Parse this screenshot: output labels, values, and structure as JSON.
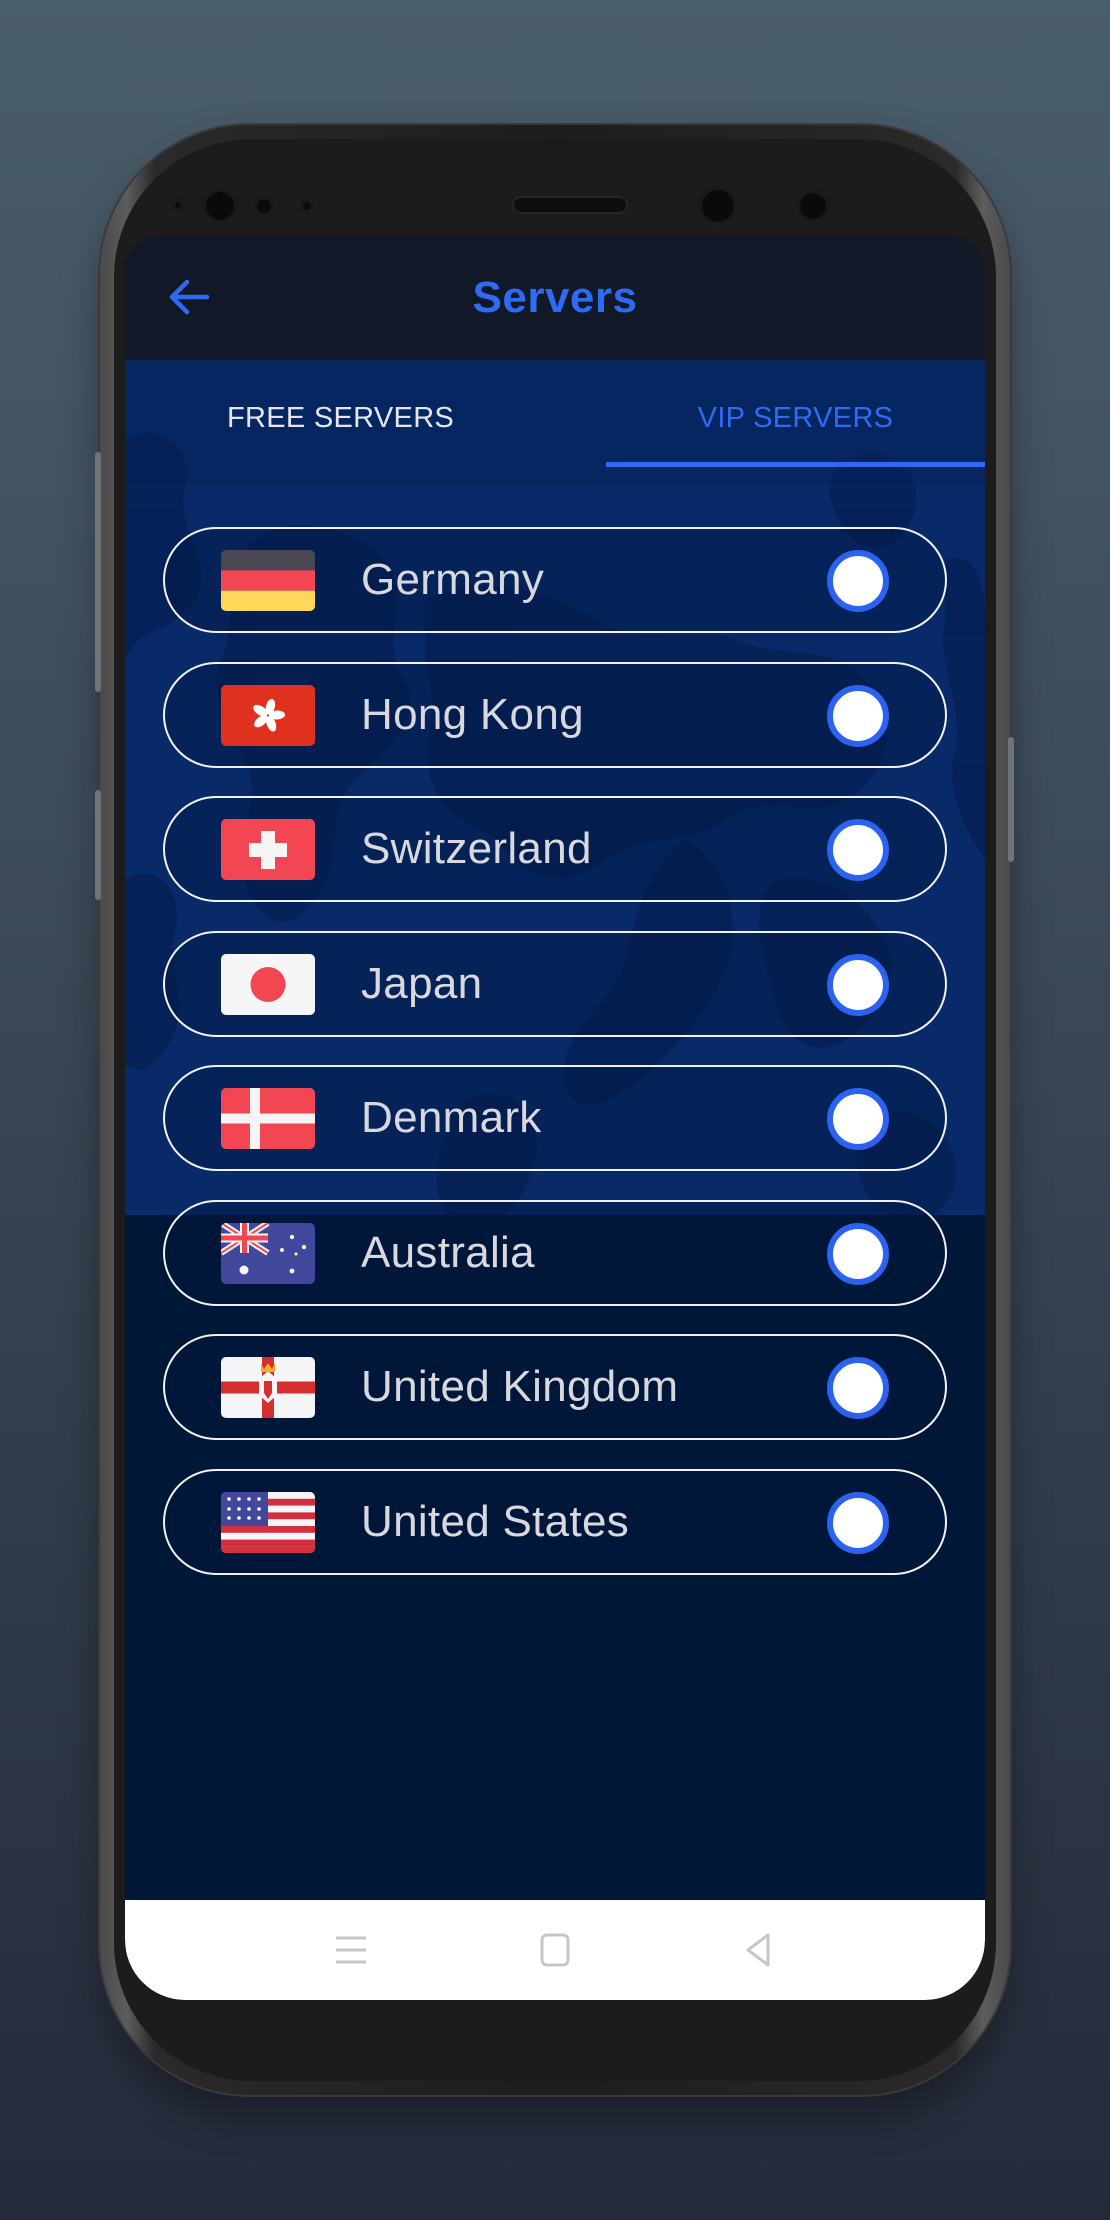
{
  "header": {
    "title": "Servers",
    "back_icon": "arrow-left-icon"
  },
  "tabs": [
    {
      "label": "FREE SERVERS",
      "active": false
    },
    {
      "label": "VIP SERVERS",
      "active": true
    }
  ],
  "servers": [
    {
      "name": "Germany",
      "flag": "germany-flag",
      "selected": false
    },
    {
      "name": "Hong Kong",
      "flag": "hong-kong-flag",
      "selected": false
    },
    {
      "name": "Switzerland",
      "flag": "switzerland-flag",
      "selected": false
    },
    {
      "name": "Japan",
      "flag": "japan-flag",
      "selected": false
    },
    {
      "name": "Denmark",
      "flag": "denmark-flag",
      "selected": false
    },
    {
      "name": "Australia",
      "flag": "australia-flag",
      "selected": false
    },
    {
      "name": "United Kingdom",
      "flag": "northern-ireland-flag",
      "selected": false
    },
    {
      "name": "United States",
      "flag": "united-states-flag",
      "selected": false
    }
  ],
  "navbar": {
    "recent_icon": "menu-lines-icon",
    "home_icon": "square-home-icon",
    "back_icon": "triangle-back-icon"
  },
  "colors": {
    "accent": "#2f6bf2",
    "appbar": "#111827",
    "background": "#001838",
    "row_border": "#f2f2f6",
    "row_text": "#d8d8de"
  }
}
